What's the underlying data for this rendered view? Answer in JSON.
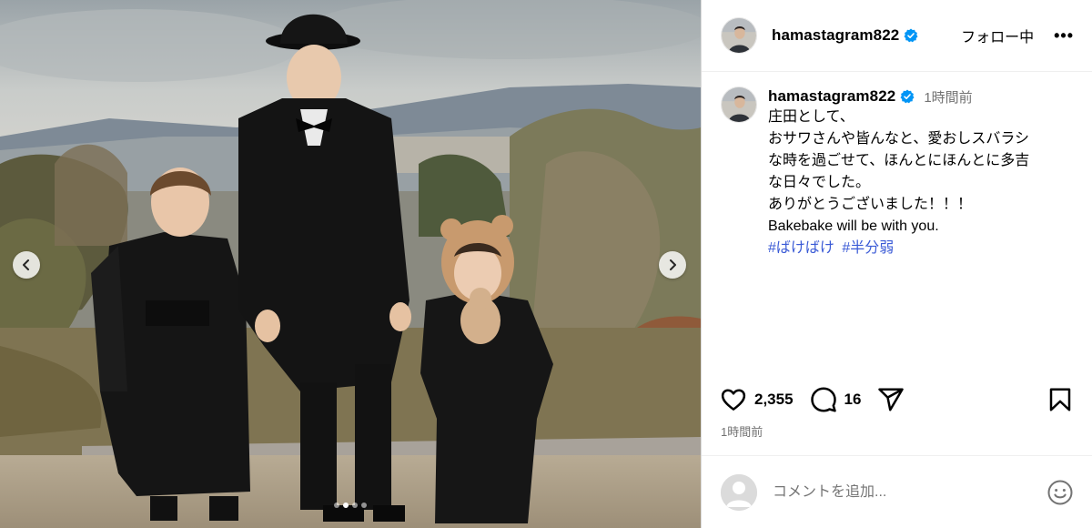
{
  "post": {
    "username": "hamastagram822",
    "follow_label": "フォロー中",
    "more_label": "•••",
    "caption_time": "1時間前",
    "caption_lines": [
      "庄田として、",
      "おサワさんや皆んなと、愛おしスバラシ",
      "な時を過ごせて、ほんとにほんとに多吉",
      "な日々でした。",
      "ありがとうございました！！！",
      "Bakebake will be with you."
    ],
    "hashtags": [
      "#ばけばけ",
      "#半分弱"
    ],
    "likes": "2,355",
    "comments": "16",
    "post_time": "1時間前",
    "comment_placeholder": "コメントを追加..."
  },
  "carousel": {
    "slide_count": 4,
    "active_index": 1
  },
  "colors": {
    "verified_blue": "#0095f6",
    "hashtag": "#3b5bd6",
    "secondary_text": "#737373"
  },
  "icons": [
    "chevron-left-icon",
    "chevron-right-icon",
    "verified-badge-icon",
    "heart-icon",
    "comment-icon",
    "share-icon",
    "bookmark-icon",
    "emoji-icon"
  ]
}
